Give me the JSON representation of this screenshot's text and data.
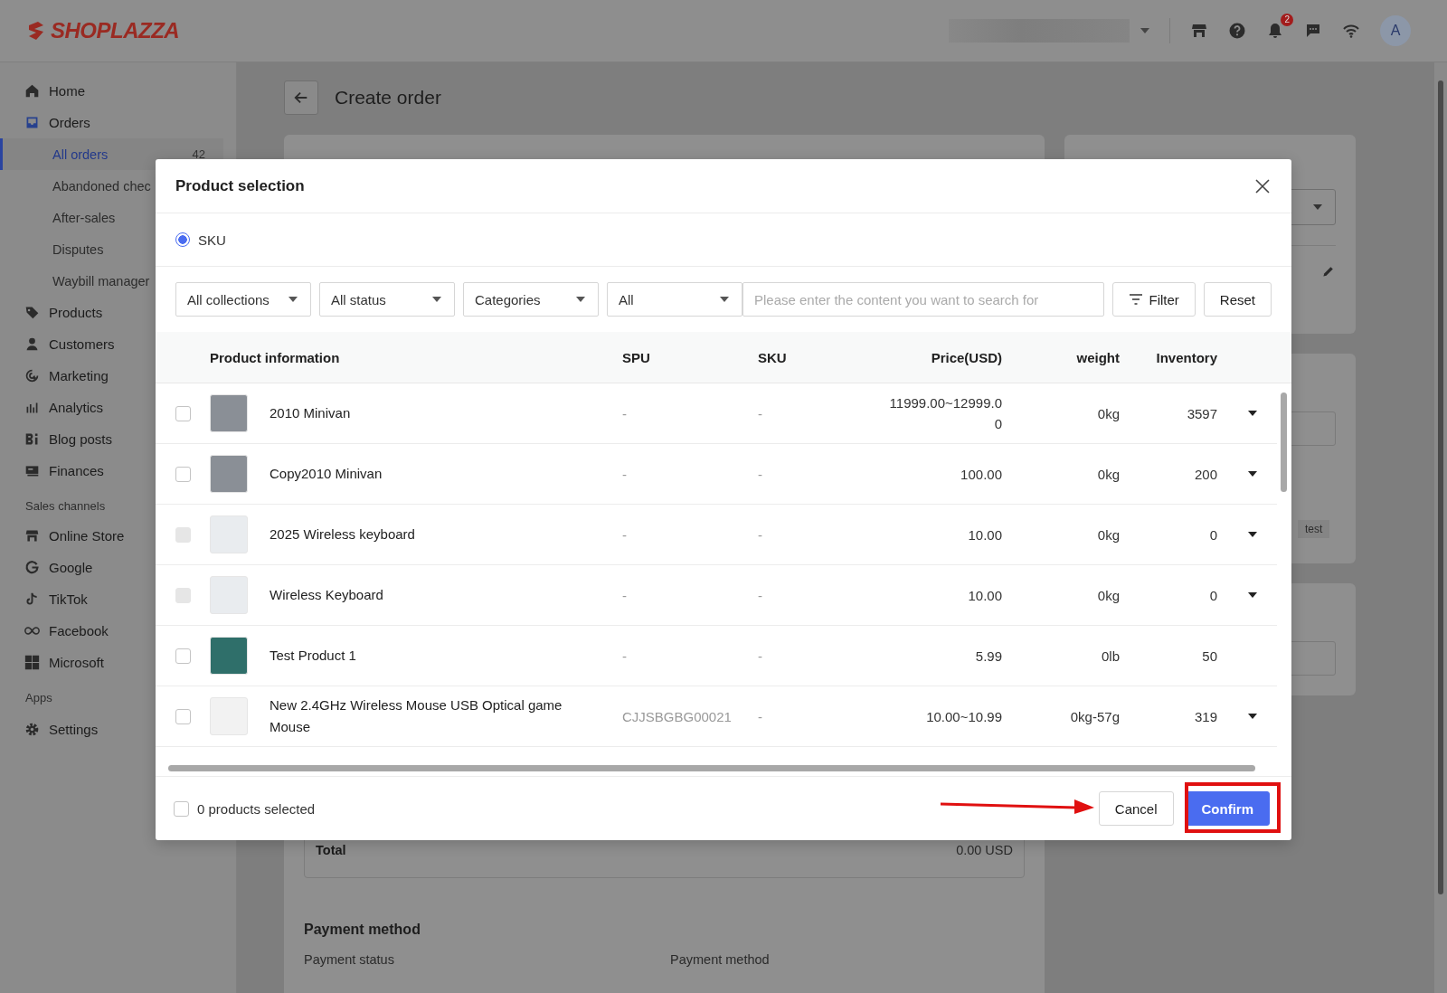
{
  "header": {
    "logo": "SHOPLAZZA",
    "notification_count": "2",
    "avatar": "A"
  },
  "sidebar": {
    "sections": [
      {
        "items": [
          {
            "label": "Home",
            "kind": "home",
            "selected": false
          },
          {
            "label": "Orders",
            "kind": "inbox",
            "selected": false,
            "expanded": true,
            "children": [
              {
                "label": "All orders",
                "selected": true,
                "count": "42"
              },
              {
                "label": "Abandoned chec",
                "selected": false
              },
              {
                "label": "After-sales",
                "selected": false
              },
              {
                "label": "Disputes",
                "selected": false
              },
              {
                "label": "Waybill manager",
                "selected": false
              }
            ]
          },
          {
            "label": "Products",
            "kind": "tag",
            "selected": false
          },
          {
            "label": "Customers",
            "kind": "person",
            "selected": false
          },
          {
            "label": "Marketing",
            "kind": "target",
            "selected": false
          },
          {
            "label": "Analytics",
            "kind": "bars",
            "selected": false
          },
          {
            "label": "Blog posts",
            "kind": "blog",
            "selected": false
          },
          {
            "label": "Finances",
            "kind": "card",
            "selected": false
          }
        ]
      },
      {
        "title": "Sales channels",
        "items": [
          {
            "label": "Online Store",
            "kind": "store",
            "selected": false
          },
          {
            "label": "Google",
            "kind": "google",
            "selected": false
          },
          {
            "label": "TikTok",
            "kind": "note",
            "selected": false
          },
          {
            "label": "Facebook",
            "kind": "infinity",
            "selected": false
          },
          {
            "label": "Microsoft",
            "kind": "windows",
            "selected": false
          }
        ]
      },
      {
        "title": "Apps"
      },
      {
        "items": [
          {
            "label": "Settings",
            "kind": "gear",
            "selected": false
          }
        ]
      }
    ]
  },
  "page": {
    "title": "Create order",
    "total_label": "Total",
    "total_value": "0.00 USD",
    "payment_title": "Payment method",
    "payment_fields": [
      "Payment status",
      "Payment method"
    ],
    "tag": "test"
  },
  "modal": {
    "title": "Product selection",
    "modes": [
      {
        "label": "SKU",
        "selected": true
      }
    ],
    "filters": [
      {
        "label": "All collections"
      },
      {
        "label": "All status"
      },
      {
        "label": "Categories"
      },
      {
        "label": "All"
      }
    ],
    "search": {
      "placeholder": "Please enter the content you want to search for"
    },
    "filter_button": "Filter",
    "reset_button": "Reset",
    "columns": [
      "Product information",
      "SPU",
      "SKU",
      "Price(USD)",
      "weight",
      "Inventory"
    ],
    "rows": [
      {
        "kind": "car",
        "name": "2010 Minivan",
        "spu": "-",
        "sku": "-",
        "price": "11999.00~12999.00",
        "weight": "0kg",
        "inventory": "3597",
        "checked": false,
        "disabled": false,
        "expandable": true
      },
      {
        "kind": "car",
        "name": "Copy2010 Minivan",
        "spu": "-",
        "sku": "-",
        "price": "100.00",
        "weight": "0kg",
        "inventory": "200",
        "checked": false,
        "disabled": false,
        "expandable": true
      },
      {
        "kind": "keyboard",
        "name": "2025 Wireless keyboard",
        "spu": "-",
        "sku": "-",
        "price": "10.00",
        "weight": "0kg",
        "inventory": "0",
        "checked": false,
        "disabled": true,
        "expandable": true
      },
      {
        "kind": "keyboard",
        "name": "Wireless Keyboard",
        "spu": "-",
        "sku": "-",
        "price": "10.00",
        "weight": "0kg",
        "inventory": "0",
        "checked": false,
        "disabled": true,
        "expandable": true
      },
      {
        "kind": "photo",
        "name": "Test Product 1",
        "spu": "-",
        "sku": "-",
        "price": "5.99",
        "weight": "0lb",
        "inventory": "50",
        "checked": false,
        "disabled": false,
        "expandable": false
      },
      {
        "kind": "mouse",
        "name": "New 2.4GHz Wireless Mouse USB Optical game Mouse",
        "spu": "CJJSBGBG00021",
        "sku": "-",
        "price": "10.00~10.99",
        "weight": "0kg-57g",
        "inventory": "319",
        "checked": false,
        "disabled": false,
        "expandable": true
      }
    ],
    "footer": {
      "all_checked": false,
      "selected_text": "0 products selected"
    },
    "cancel_button": "Cancel",
    "confirm_button": "Confirm"
  },
  "annotation": {
    "arrow": true,
    "highlight_box": true
  }
}
